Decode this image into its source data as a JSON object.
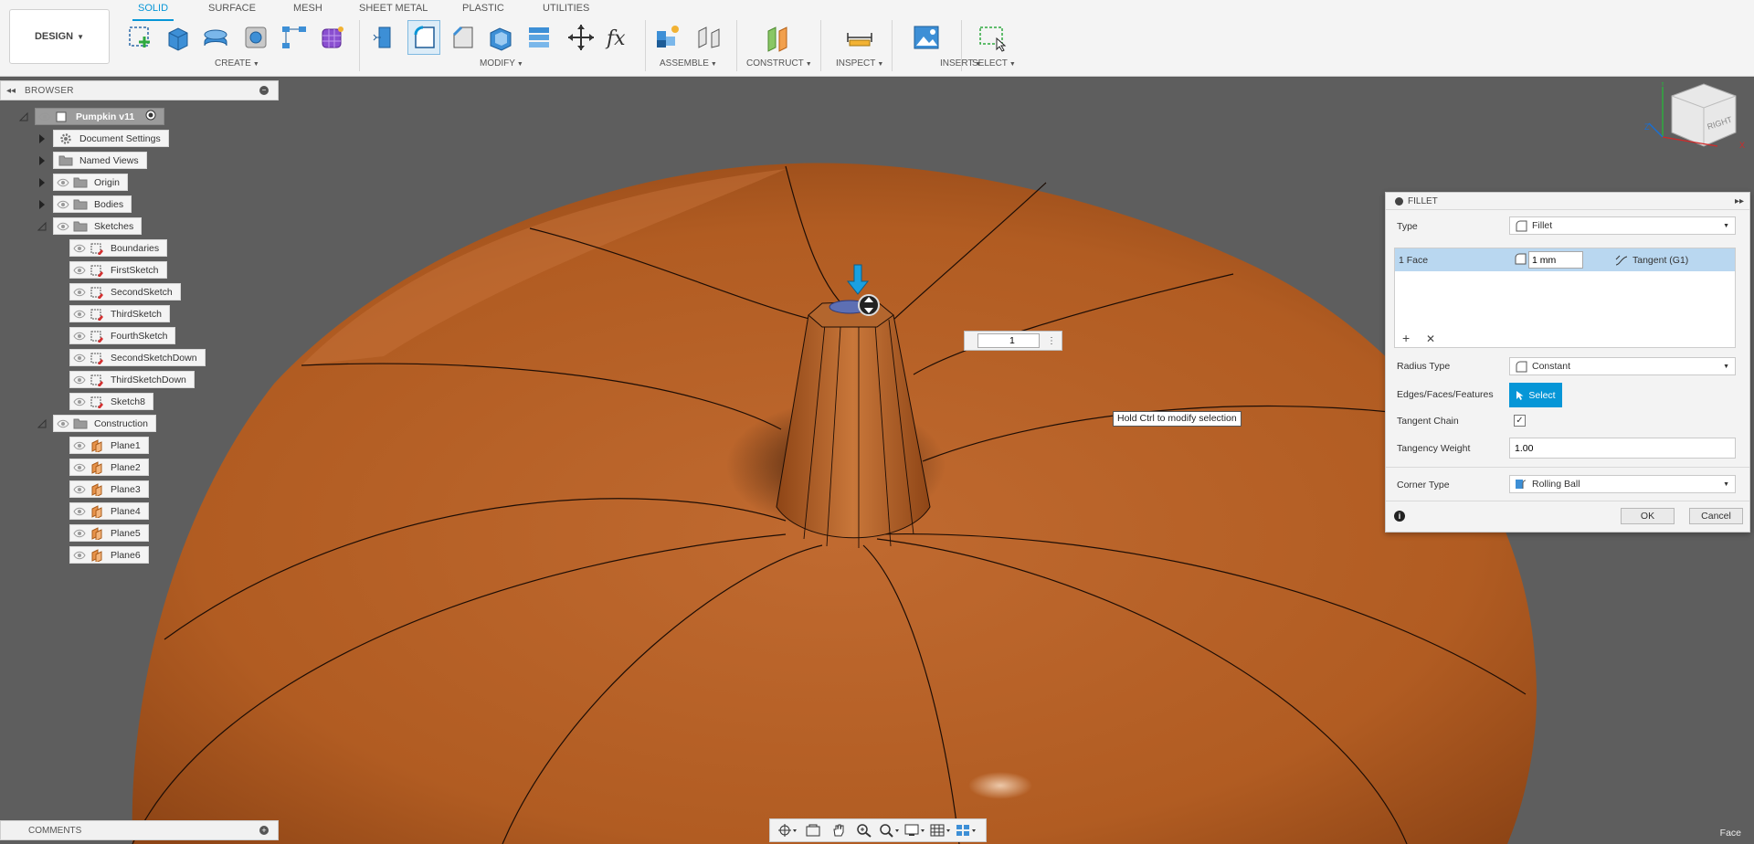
{
  "toolbar": {
    "workspace_label": "DESIGN",
    "tabs": [
      "SOLID",
      "SURFACE",
      "MESH",
      "SHEET METAL",
      "PLASTIC",
      "UTILITIES"
    ],
    "groups": {
      "create": "CREATE",
      "modify": "MODIFY",
      "assemble": "ASSEMBLE",
      "construct": "CONSTRUCT",
      "inspect": "INSPECT",
      "insert": "INSERT",
      "select": "SELECT"
    }
  },
  "browser": {
    "title": "BROWSER",
    "root": "Pumpkin v11",
    "items": {
      "document_settings": "Document Settings",
      "named_views": "Named Views",
      "origin": "Origin",
      "bodies": "Bodies",
      "sketches": "Sketches",
      "sketch_list": [
        "Boundaries",
        "FirstSketch",
        "SecondSketch",
        "ThirdSketch",
        "FourthSketch",
        "SecondSketchDown",
        "ThirdSketchDown",
        "Sketch8"
      ],
      "construction": "Construction",
      "plane_list": [
        "Plane1",
        "Plane2",
        "Plane3",
        "Plane4",
        "Plane5",
        "Plane6"
      ]
    }
  },
  "fillet": {
    "title": "FILLET",
    "type_label": "Type",
    "type_value": "Fillet",
    "selection": {
      "face": "1 Face",
      "radius": "1 mm",
      "continuity": "Tangent (G1)"
    },
    "radius_type_label": "Radius Type",
    "radius_type_value": "Constant",
    "edges_label": "Edges/Faces/Features",
    "select_button": "Select",
    "tangent_chain_label": "Tangent Chain",
    "tangent_chain_checked": true,
    "tangency_weight_label": "Tangency Weight",
    "tangency_weight_value": "1.00",
    "corner_type_label": "Corner Type",
    "corner_type_value": "Rolling Ball",
    "ok": "OK",
    "cancel": "Cancel"
  },
  "canvas": {
    "tooltip": "Hold Ctrl to modify selection",
    "dimension_value": "1",
    "viewcube_label": "RIGHT",
    "axis_y": "Y",
    "axis_z": "Z",
    "axis_x": "X"
  },
  "comments": {
    "title": "COMMENTS"
  },
  "status": {
    "selection_filter": "Face"
  },
  "colors": {
    "accent": "#0696d7",
    "pumpkin": "#b9622a",
    "pumpkin_dark": "#7a3a14",
    "background": "#5e5e5e"
  }
}
